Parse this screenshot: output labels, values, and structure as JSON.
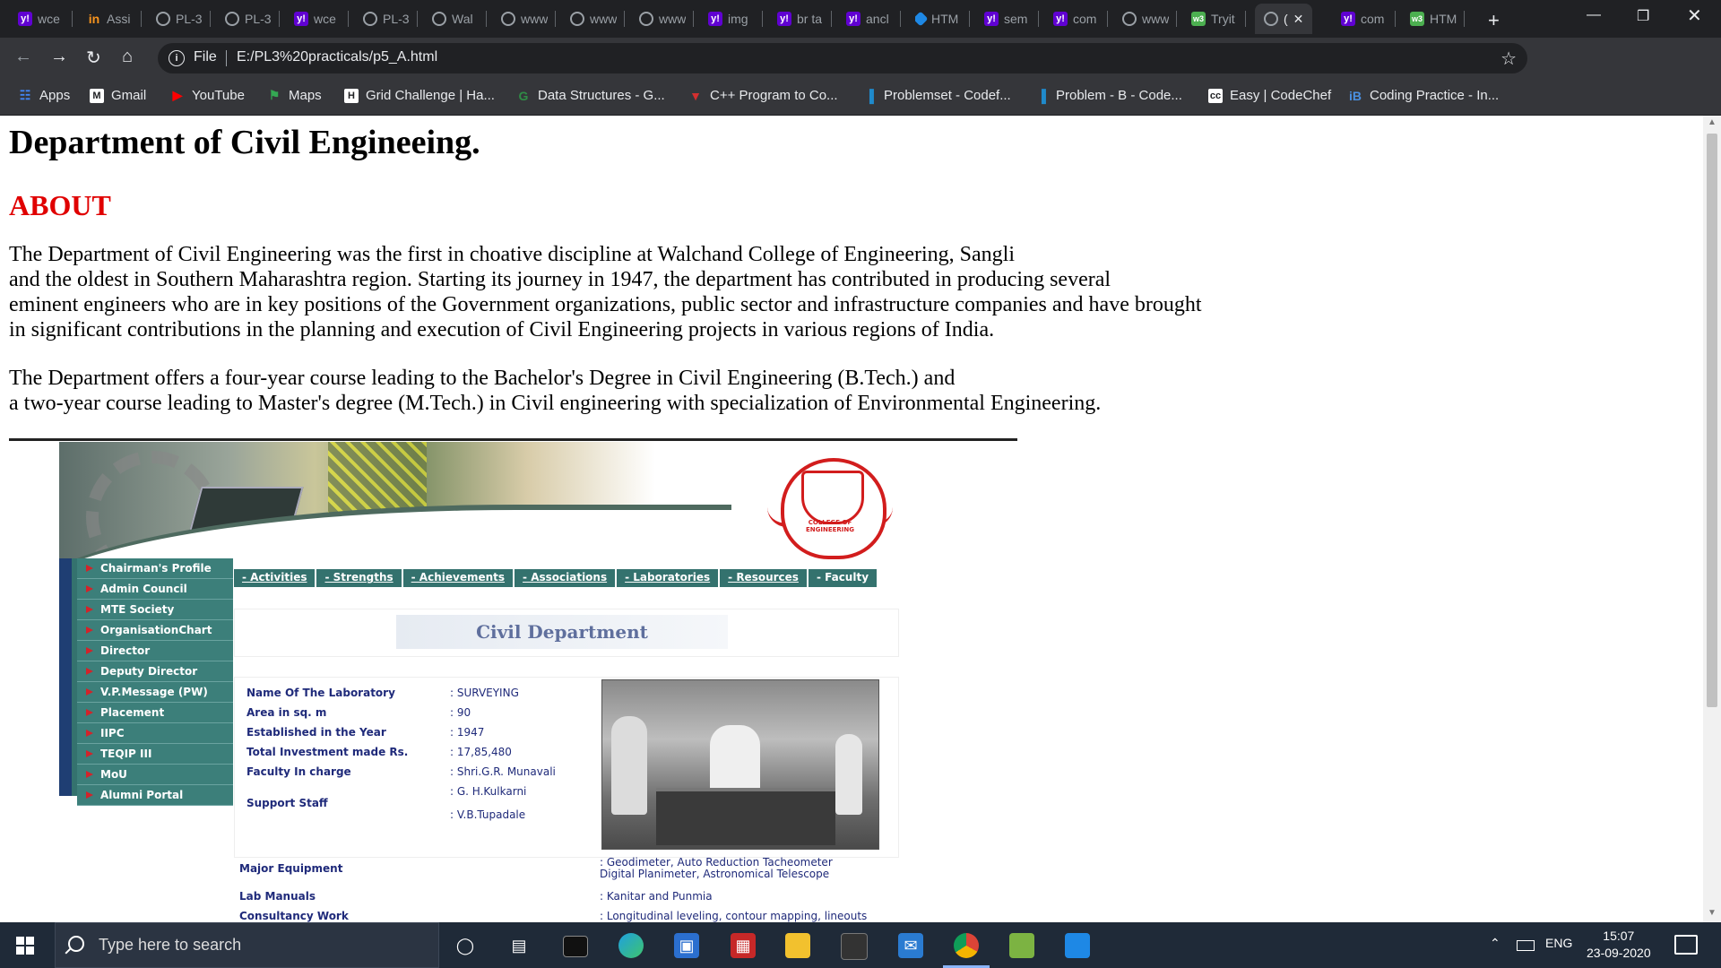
{
  "browser": {
    "tabs": [
      {
        "label": "wce",
        "icon": "yahoo-icon"
      },
      {
        "label": "Assi",
        "icon": "internshala-icon"
      },
      {
        "label": "PL-3",
        "icon": "globe-icon"
      },
      {
        "label": "PL-3",
        "icon": "globe-icon"
      },
      {
        "label": "wce",
        "icon": "yahoo-icon"
      },
      {
        "label": "PL-3",
        "icon": "globe-icon"
      },
      {
        "label": "Wal",
        "icon": "globe-icon"
      },
      {
        "label": "www",
        "icon": "globe-icon"
      },
      {
        "label": "www",
        "icon": "globe-icon"
      },
      {
        "label": "www",
        "icon": "globe-icon"
      },
      {
        "label": "img",
        "icon": "yahoo-icon"
      },
      {
        "label": "br ta",
        "icon": "yahoo-icon"
      },
      {
        "label": "ancl",
        "icon": "yahoo-icon"
      },
      {
        "label": "HTM",
        "icon": "html-icon"
      },
      {
        "label": "sem",
        "icon": "yahoo-icon"
      },
      {
        "label": "com",
        "icon": "yahoo-icon"
      },
      {
        "label": "www",
        "icon": "globe-icon"
      },
      {
        "label": "Tryit",
        "icon": "w3schools-icon"
      },
      {
        "label": "(",
        "icon": "globe-icon",
        "active": true
      },
      {
        "label": "com",
        "icon": "yahoo-icon"
      },
      {
        "label": "HTM",
        "icon": "w3schools-icon"
      }
    ],
    "address": {
      "label": "File",
      "url": "E:/PL3%20practicals/p5_A.html"
    },
    "bookmarks": [
      {
        "label": "Apps",
        "icon": "apps-grid-icon"
      },
      {
        "label": "Gmail",
        "icon": "gmail-icon"
      },
      {
        "label": "YouTube",
        "icon": "youtube-icon"
      },
      {
        "label": "Maps",
        "icon": "maps-icon"
      },
      {
        "label": "Grid Challenge | Ha...",
        "icon": "hackerrank-icon"
      },
      {
        "label": "Data Structures - G...",
        "icon": "geeksforgeeks-icon"
      },
      {
        "label": "C++ Program to Co...",
        "icon": "code-icon"
      },
      {
        "label": "Problemset - Codef...",
        "icon": "codeforces-icon"
      },
      {
        "label": "Problem - B - Code...",
        "icon": "codeforces-icon"
      },
      {
        "label": "Easy | CodeChef",
        "icon": "codechef-icon"
      },
      {
        "label": "Coding Practice - In...",
        "icon": "interviewbit-icon"
      }
    ]
  },
  "page": {
    "title": "Department of Civil Engineeing.",
    "about_heading": "ABOUT",
    "para1": [
      "The Department of Civil Engineering was the first in choative discipline at Walchand College of Engineering, Sangli",
      "and the oldest in Southern Maharashtra region. Starting its journey in 1947, the department has contributed in producing several",
      "eminent engineers who are in key positions of the Government organizations, public sector and infrastructure companies and have brought",
      "in significant contributions in the planning and execution of Civil Engineering projects in various regions of India."
    ],
    "para2": [
      "The Department offers a four-year course leading to the Bachelor's Degree in Civil Engineering (B.Tech.) and",
      "a two-year course leading to Master's degree (M.Tech.) in Civil engineering with specialization of Environmental Engineering."
    ]
  },
  "site_image": {
    "emblem_text": "COLLEGE OF ENGINEERING",
    "left_nav": [
      "Chairman's Profile",
      "Admin Council",
      "MTE Society",
      "OrganisationChart",
      "Director",
      "Deputy Director",
      "V.P.Message (PW)",
      "Placement",
      "IIPC",
      "TEQIP III",
      "MoU",
      "Alumni Portal"
    ],
    "top_nav": [
      "- Activities",
      "- Strengths",
      "- Achievements",
      "- Associations",
      "- Laboratories",
      "- Resources",
      "- Faculty"
    ],
    "dept_label": "Civil Department",
    "lab_keys": [
      "Name Of The Laboratory",
      "Area in sq. m",
      "Established in the Year",
      "Total Investment made Rs.",
      "Faculty In charge",
      "Support Staff"
    ],
    "lab_values": [
      ": SURVEYING",
      ": 90",
      ": 1947",
      ": 17,85,480",
      ": Shri.G.R. Munavali",
      ": G. H.Kulkarni",
      ": V.B.Tupadale"
    ],
    "more_keys": [
      "Major Equipment",
      "Lab Manuals",
      "Consultancy Work"
    ],
    "more_values": [
      ": Geodimeter, Auto Reduction Tacheometer",
      "Digital Planimeter, Astronomical Telescope",
      ": Kanitar and Punmia",
      ": Longitudinal leveling, contour mapping, lineouts"
    ]
  },
  "taskbar": {
    "search_placeholder": "Type here to search",
    "language": "ENG",
    "time": "15:07",
    "date": "23-09-2020"
  }
}
